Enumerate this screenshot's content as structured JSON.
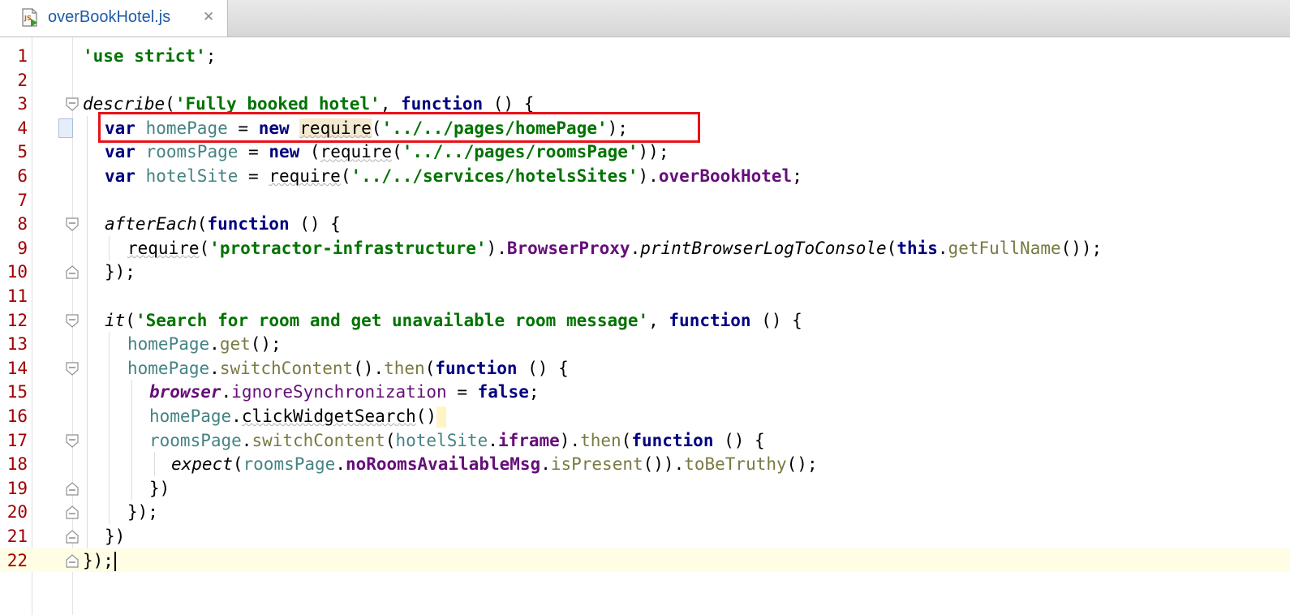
{
  "tab": {
    "filename": "overBookHotel.js",
    "close_glyph": "✕",
    "icon": "javascript-file-icon"
  },
  "editor": {
    "line_numbers": [
      "1",
      "2",
      "3",
      "4",
      "5",
      "6",
      "7",
      "8",
      "9",
      "10",
      "11",
      "12",
      "13",
      "14",
      "15",
      "16",
      "17",
      "18",
      "19",
      "20",
      "21",
      "22"
    ],
    "current_line": "22"
  },
  "colors": {
    "keyword": "#000080",
    "string": "#007300",
    "variable": "#458383",
    "method": "#7a7a43",
    "property": "#660e7a",
    "line_number": "#a00000",
    "highlight_box": "#e8111a",
    "current_line_bg": "#fffde4"
  },
  "code": {
    "l1": {
      "s1": "'use strict'",
      "p1": ";"
    },
    "l3": {
      "f1": "describe",
      "p1": "(",
      "s1": "'Fully booked hotel'",
      "p2": ", ",
      "k1": "function",
      "p3": " () {"
    },
    "l4": {
      "k1": "var",
      "p0": " ",
      "v1": "homePage",
      "p1": " = ",
      "k2": "new",
      "p2": " ",
      "r1": "require",
      "p3": "(",
      "s1": "'../../pages/homePage'",
      "p4": ");"
    },
    "l5": {
      "k1": "var",
      "p0": " ",
      "v1": "roomsPage",
      "p1": " = ",
      "k2": "new",
      "p2": " (",
      "r1": "require",
      "p3": "(",
      "s1": "'../../pages/roomsPage'",
      "p4": "));"
    },
    "l6": {
      "k1": "var",
      "p0": " ",
      "v1": "hotelSite",
      "p1": " = ",
      "r1": "require",
      "p2": "(",
      "s1": "'../../services/hotelsSites'",
      "p3": ").",
      "pr1": "overBookHotel",
      "p4": ";"
    },
    "l8": {
      "f1": "afterEach",
      "p1": "(",
      "k1": "function",
      "p2": " () {"
    },
    "l9": {
      "r1": "require",
      "p1": "(",
      "s1": "'protractor-infrastructure'",
      "p2": ").",
      "pr1": "BrowserProxy",
      "p3": ".",
      "f1": "printBrowserLogToConsole",
      "p4": "(",
      "k1": "this",
      "p5": ".",
      "m1": "getFullName",
      "p6": "());"
    },
    "l10": {
      "p1": "});"
    },
    "l12": {
      "f1": "it",
      "p1": "(",
      "s1": "'Search for room and get unavailable room message'",
      "p2": ", ",
      "k1": "function",
      "p3": " () {"
    },
    "l13": {
      "v1": "homePage",
      "p1": ".",
      "m1": "get",
      "p2": "();"
    },
    "l14": {
      "v1": "homePage",
      "p1": ".",
      "m1": "switchContent",
      "p2": "().",
      "m2": "then",
      "p3": "(",
      "k1": "function",
      "p4": " () {"
    },
    "l15": {
      "g1": "browser",
      "p1": ".",
      "pr1": "ignoreSynchronization",
      "p2": " = ",
      "k1": "false",
      "p3": ";"
    },
    "l16": {
      "v1": "homePage",
      "p1": ".",
      "m1": "clickWidgetSearch",
      "p2": "()"
    },
    "l17": {
      "v1": "roomsPage",
      "p1": ".",
      "m1": "switchContent",
      "p2": "(",
      "v2": "hotelSite",
      "p3": ".",
      "pr1": "iframe",
      "p4": ").",
      "m2": "then",
      "p5": "(",
      "k1": "function",
      "p6": " () {"
    },
    "l18": {
      "f1": "expect",
      "p1": "(",
      "v1": "roomsPage",
      "p2": ".",
      "pr1": "noRoomsAvailableMsg",
      "p3": ".",
      "m1": "isPresent",
      "p4": "()).",
      "m2": "toBeTruthy",
      "p5": "();"
    },
    "l19": {
      "p1": "})"
    },
    "l20": {
      "p1": "});"
    },
    "l21": {
      "p1": "})"
    },
    "l22": {
      "p1": "});"
    }
  }
}
